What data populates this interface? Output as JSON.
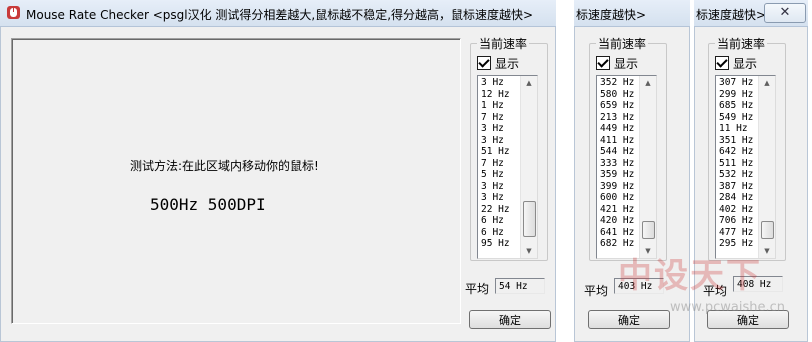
{
  "title_bar": {
    "title": "Mouse Rate Checker  <psgl汉化  测试得分相差越大,鼠标越不稳定,得分越高，鼠标速度越快>",
    "close_glyph": "✕",
    "second_title": "标速度越快>",
    "third_title": "标速度越快>"
  },
  "test_area": {
    "instruction": "测试方法:在此区域内移动你的鼠标!",
    "mouse_rate": "500Hz  500DPI"
  },
  "panels": [
    {
      "group_label": "当前速率",
      "show_label": "显示",
      "show_checked": true,
      "items": [
        "3 Hz",
        "12 Hz",
        "1 Hz",
        "7 Hz",
        "3 Hz",
        "3 Hz",
        "51 Hz",
        "7 Hz",
        "5 Hz",
        "3 Hz",
        "3 Hz",
        "22 Hz",
        "6 Hz",
        "6 Hz",
        "95 Hz"
      ],
      "average_label": "平均",
      "average_value": "54 Hz",
      "ok_label": "确定"
    },
    {
      "group_label": "当前速率",
      "show_label": "显示",
      "show_checked": true,
      "items": [
        "352 Hz",
        "580 Hz",
        "659 Hz",
        "213 Hz",
        "449 Hz",
        "411 Hz",
        "544 Hz",
        "333 Hz",
        "359 Hz",
        "399 Hz",
        "600 Hz",
        "421 Hz",
        "420 Hz",
        "641 Hz",
        "682 Hz"
      ],
      "average_label": "平均",
      "average_value": "403 Hz",
      "ok_label": "确定"
    },
    {
      "group_label": "当前速率",
      "show_label": "显示",
      "show_checked": true,
      "items": [
        "307 Hz",
        "299 Hz",
        "685 Hz",
        "549 Hz",
        "11 Hz",
        "351 Hz",
        "642 Hz",
        "511 Hz",
        "532 Hz",
        "387 Hz",
        "284 Hz",
        "402 Hz",
        "706 Hz",
        "477 Hz",
        "295 Hz"
      ],
      "average_label": "平均",
      "average_value": "408 Hz",
      "ok_label": "确定"
    }
  ],
  "scrollbar": {
    "up_glyph": "▲",
    "down_glyph": "▼"
  },
  "watermark": {
    "logo": "中设天下",
    "url": "www.pcwaishe.cn"
  }
}
